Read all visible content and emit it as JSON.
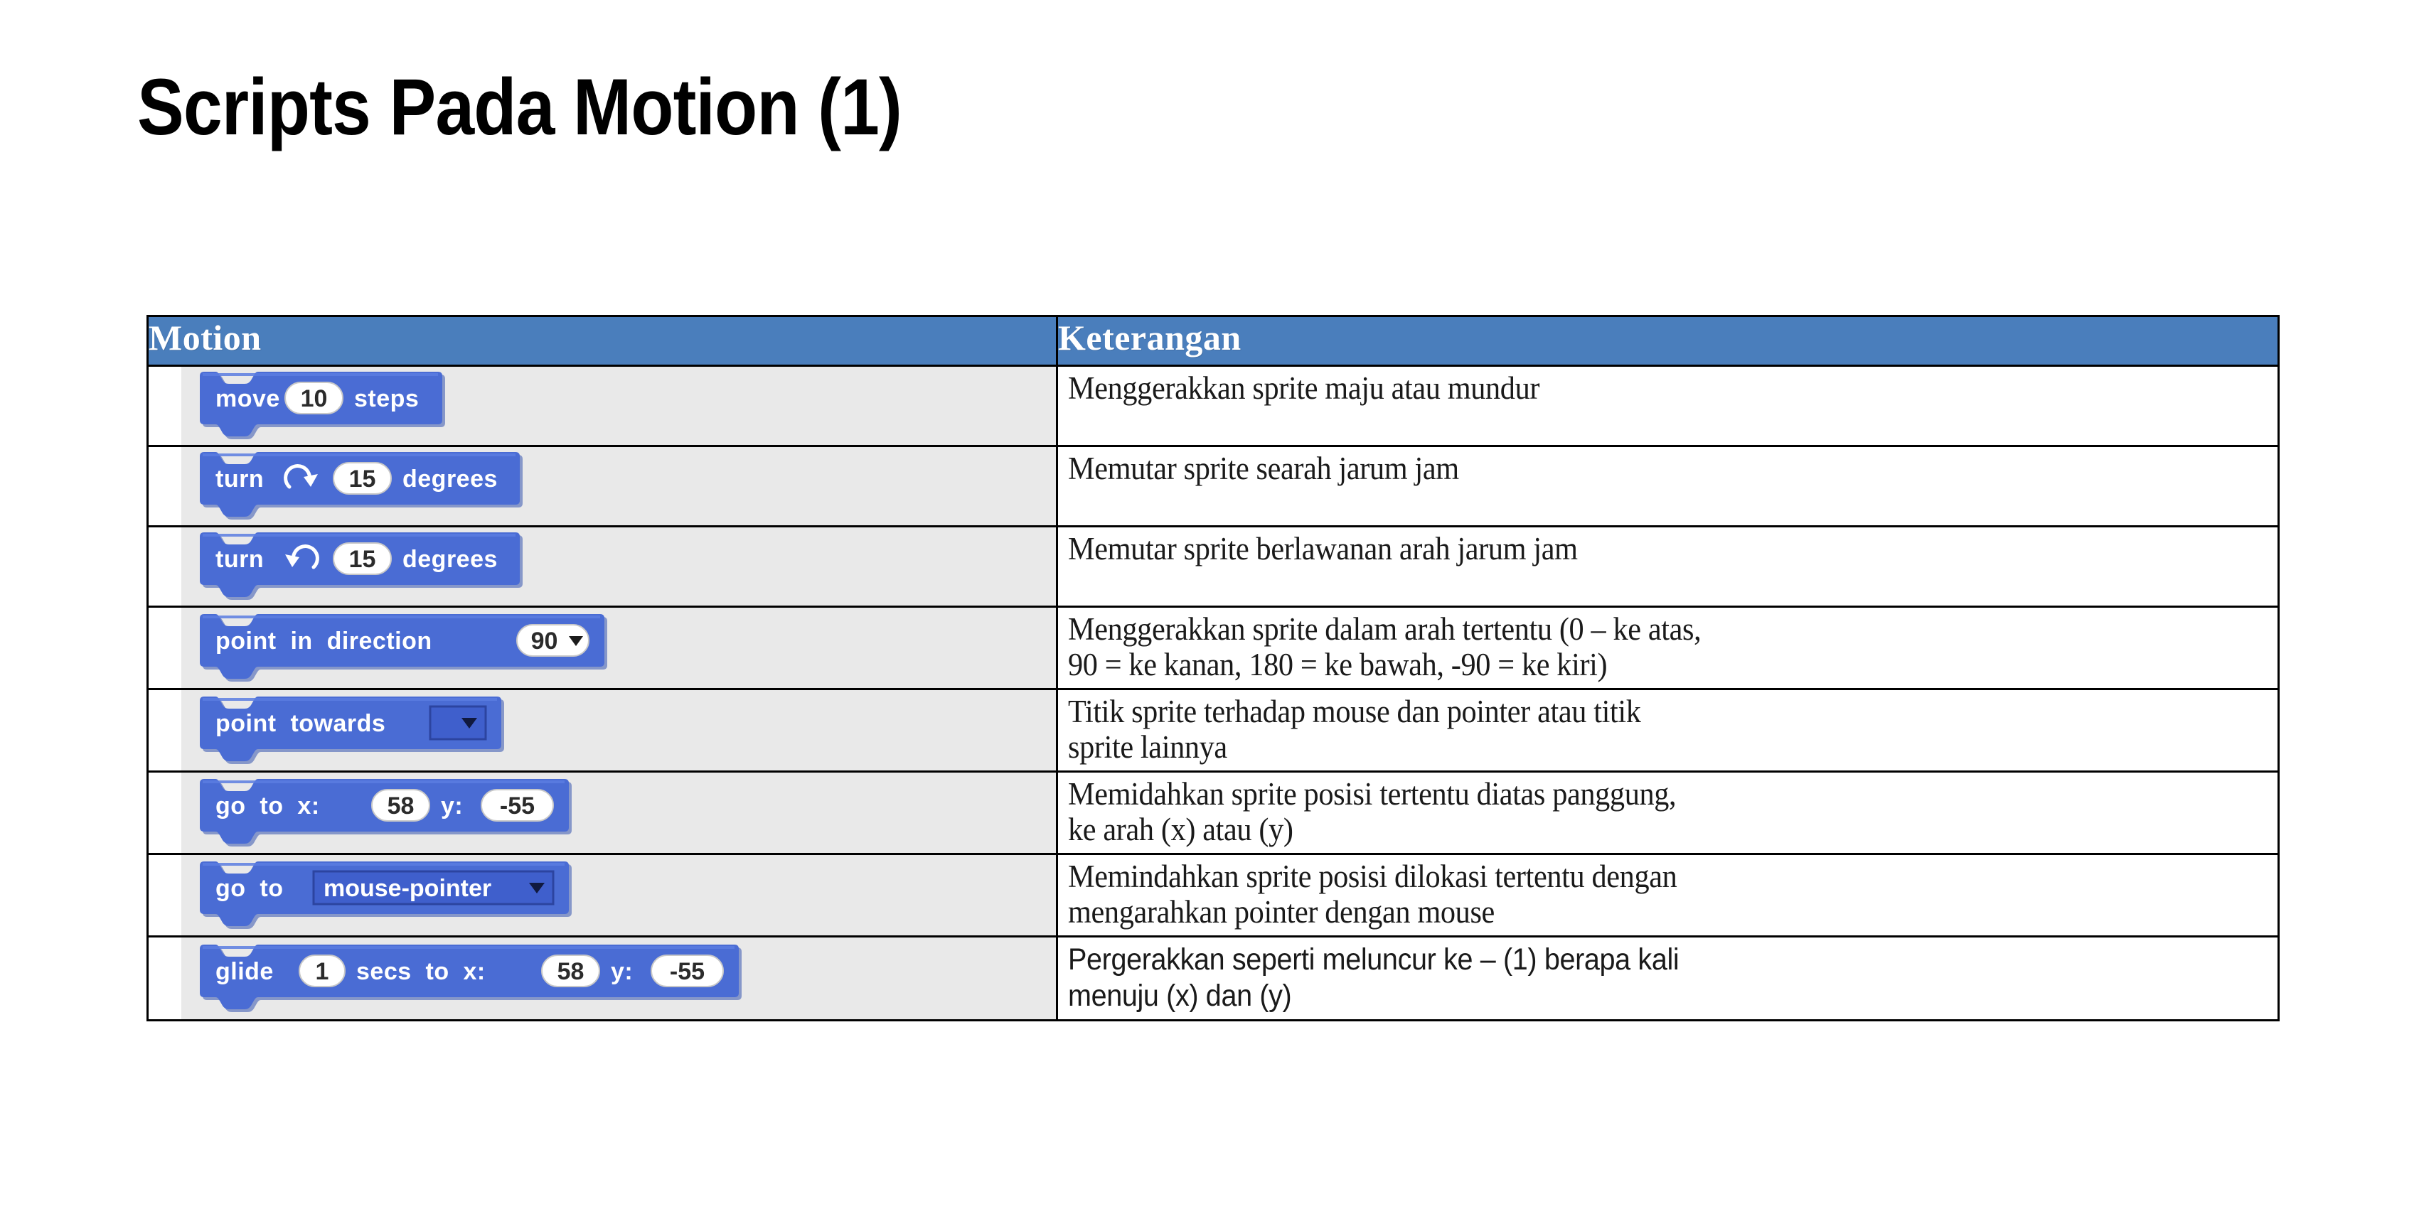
{
  "slide": {
    "title": "Scripts Pada Motion (1)",
    "accent_color": "#4a7ebc",
    "block_color": "#4a6cd4",
    "block_strip_color": "#e9e9e9",
    "border_color": "#000000",
    "header_text_color": "#ffffff"
  },
  "table": {
    "headers": {
      "col1": "Motion",
      "col2": "Keterangan"
    },
    "rows": [
      {
        "block": {
          "name": "move-steps-block",
          "parts": [
            {
              "type": "label",
              "text": "move"
            },
            {
              "type": "oval-input",
              "text": "10"
            },
            {
              "type": "label",
              "text": "steps"
            }
          ]
        },
        "description": [
          "Menggerakkan sprite maju atau mundur"
        ]
      },
      {
        "block": {
          "name": "turn-clockwise-degrees-block",
          "parts": [
            {
              "type": "label",
              "text": "turn"
            },
            {
              "type": "icon",
              "text": "turn-clockwise-icon"
            },
            {
              "type": "oval-input",
              "text": "15"
            },
            {
              "type": "label",
              "text": "degrees"
            }
          ]
        },
        "description": [
          "Memutar sprite searah jarum jam"
        ]
      },
      {
        "block": {
          "name": "turn-counterclockwise-degrees-block",
          "parts": [
            {
              "type": "label",
              "text": "turn"
            },
            {
              "type": "icon",
              "text": "turn-counterclockwise-icon"
            },
            {
              "type": "oval-input",
              "text": "15"
            },
            {
              "type": "label",
              "text": "degrees"
            }
          ]
        },
        "description": [
          "Memutar sprite berlawanan arah jarum jam"
        ]
      },
      {
        "block": {
          "name": "point-in-direction-block",
          "parts": [
            {
              "type": "label",
              "text": "point  in  direction"
            },
            {
              "type": "oval-dropdown",
              "text": "90"
            }
          ]
        },
        "description": [
          "Menggerakkan sprite dalam arah tertentu (0 – ke atas,",
          "90 = ke kanan, 180 = ke bawah, -90 = ke kiri)"
        ]
      },
      {
        "block": {
          "name": "point-towards-block",
          "parts": [
            {
              "type": "label",
              "text": "point  towards"
            },
            {
              "type": "rect-dropdown",
              "text": ""
            }
          ]
        },
        "description": [
          "Titik sprite terhadap mouse dan pointer atau titik",
          "sprite lainnya"
        ]
      },
      {
        "block": {
          "name": "go-to-xy-block",
          "parts": [
            {
              "type": "label",
              "text": "go  to  x:"
            },
            {
              "type": "oval-input",
              "text": "58"
            },
            {
              "type": "label",
              "text": "y:"
            },
            {
              "type": "oval-input",
              "text": "-55"
            }
          ]
        },
        "description": [
          "Memidahkan sprite posisi tertentu diatas panggung,",
          "ke arah (x) atau (y)"
        ]
      },
      {
        "block": {
          "name": "go-to-target-block",
          "parts": [
            {
              "type": "label",
              "text": "go  to"
            },
            {
              "type": "rect-dropdown",
              "text": "mouse-pointer"
            }
          ]
        },
        "description": [
          "Memindahkan sprite posisi dilokasi tertentu dengan",
          "mengarahkan pointer dengan mouse"
        ]
      },
      {
        "block": {
          "name": "glide-secs-to-xy-block",
          "parts": [
            {
              "type": "label",
              "text": "glide"
            },
            {
              "type": "oval-input",
              "text": "1"
            },
            {
              "type": "label",
              "text": "secs  to  x:"
            },
            {
              "type": "oval-input",
              "text": "58"
            },
            {
              "type": "label",
              "text": "y:"
            },
            {
              "type": "oval-input",
              "text": "-55"
            }
          ]
        },
        "description": [
          "Pergerakkan seperti meluncur ke – (1) berapa kali",
          "menuju (x) dan (y)"
        ]
      }
    ]
  }
}
